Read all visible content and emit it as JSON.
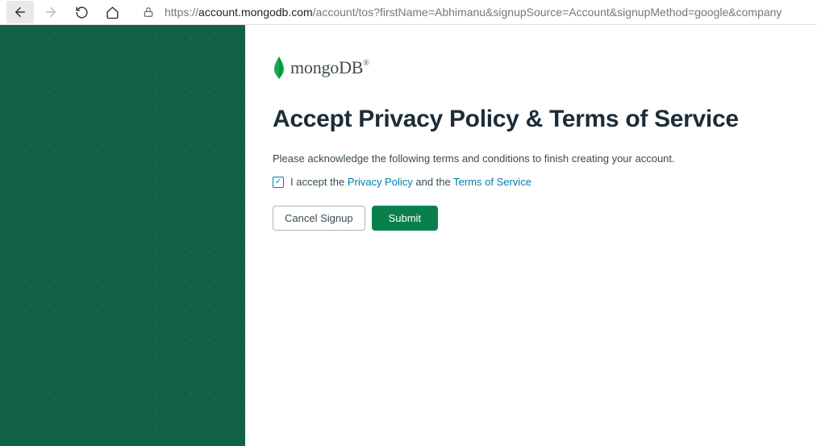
{
  "browser": {
    "url_prefix": "https://",
    "url_host": "account.mongodb.com",
    "url_path": "/account/tos?firstName=Abhimanu&signupSource=Account&signupMethod=google&company"
  },
  "logo": {
    "text": "mongoDB",
    "trademark": "®"
  },
  "page": {
    "heading": "Accept Privacy Policy & Terms of Service",
    "intro": "Please acknowledge the following terms and conditions to finish creating your account.",
    "accept_prefix": "I accept the ",
    "privacy_link": "Privacy Policy",
    "accept_mid": " and the ",
    "tos_link": "Terms of Service"
  },
  "buttons": {
    "cancel": "Cancel Signup",
    "submit": "Submit"
  },
  "colors": {
    "sidebar": "#116149",
    "link": "#007cad",
    "submit_bg": "#09804c",
    "heading": "#1c2d38"
  }
}
